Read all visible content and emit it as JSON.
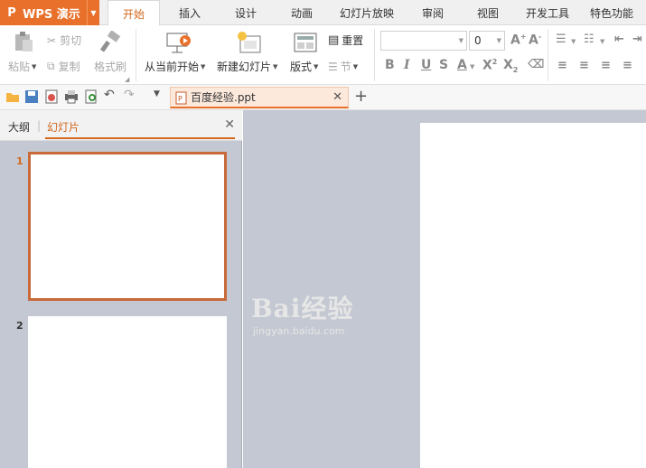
{
  "app": {
    "name": "WPS 演示",
    "logo_letter": "P"
  },
  "tabs": [
    "开始",
    "插入",
    "设计",
    "动画",
    "幻灯片放映",
    "审阅",
    "视图",
    "开发工具",
    "特色功能"
  ],
  "ribbon": {
    "paste": "粘贴",
    "cut": "剪切",
    "copy": "复制",
    "format_painter": "格式刷",
    "from_current": "从当前开始",
    "new_slide": "新建幻灯片",
    "layout": "版式",
    "reset": "重置",
    "section": "节",
    "font_name": "",
    "font_size": "0"
  },
  "document": {
    "tab_title": "百度经验.ppt"
  },
  "panel": {
    "outline_tab": "大纲",
    "slides_tab": "幻灯片",
    "slides": [
      {
        "number": "1",
        "selected": true
      },
      {
        "number": "2",
        "selected": false
      }
    ]
  },
  "watermark": {
    "brand": "Bai经验",
    "url": "jingyan.baidu.com"
  },
  "colors": {
    "accent": "#e8702a",
    "active_tab_text": "#d2691e",
    "workspace": "#c3c8d2"
  }
}
